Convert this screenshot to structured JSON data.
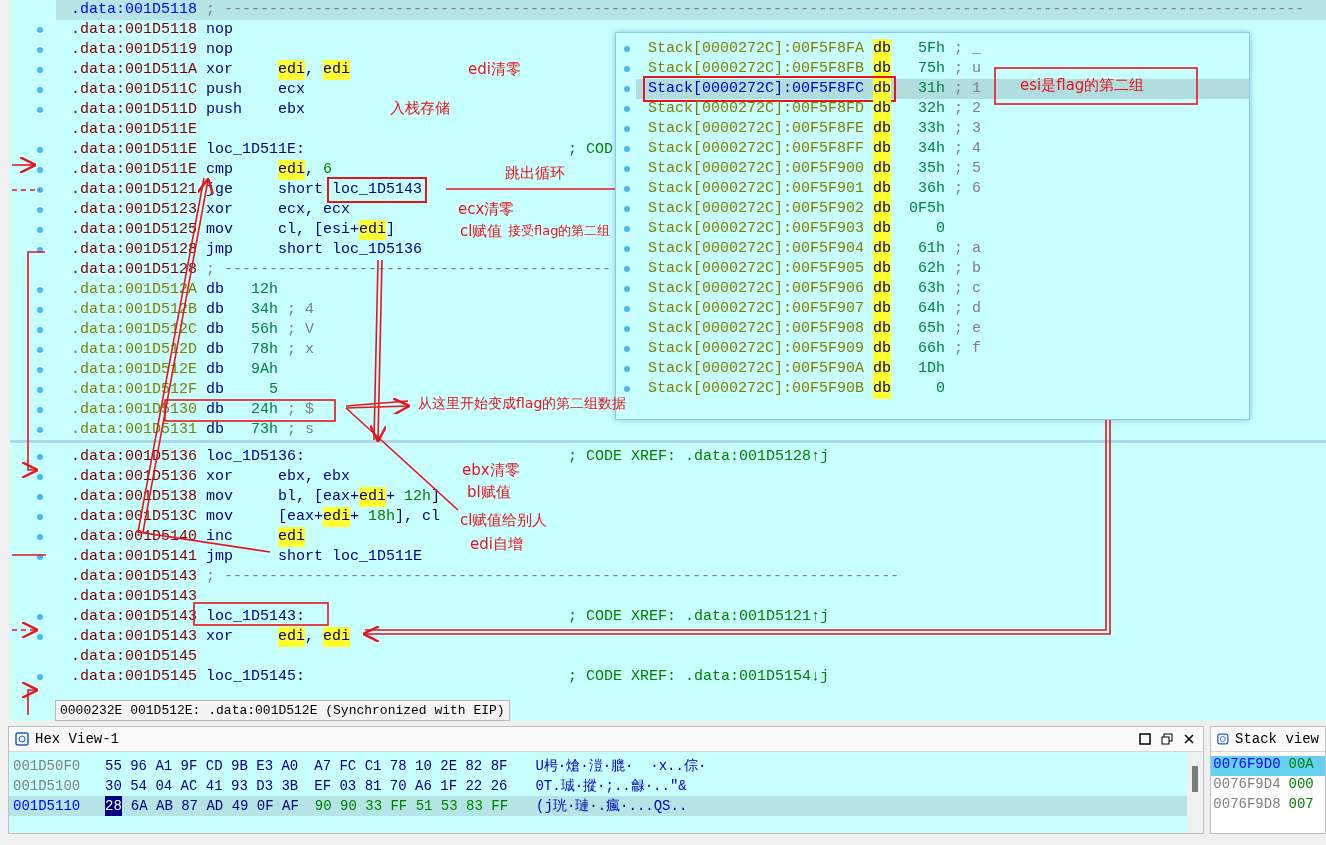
{
  "listing": {
    "lines": [
      {
        "addr": ".data:001D5118",
        "kind": "separator",
        "current": true,
        "text": "; ------------------------------------------------------------------------------------------------------------------------"
      },
      {
        "addr": ".data:001D5118",
        "kind": "insn",
        "current": false,
        "mnem": "nop"
      },
      {
        "addr": ".data:001D5119",
        "kind": "insn",
        "current": false,
        "mnem": "nop"
      },
      {
        "addr": ".data:001D511A",
        "kind": "insn",
        "current": false,
        "mnem": "xor",
        "ops": [
          {
            "text": "edi",
            "kind": "hl"
          },
          {
            "text": ",",
            "kind": "reg"
          },
          {
            "text": "edi",
            "kind": "hl"
          }
        ]
      },
      {
        "addr": ".data:001D511C",
        "kind": "insn",
        "current": false,
        "mnem": "push",
        "ops": [
          {
            "text": "ecx",
            "kind": "reg"
          }
        ]
      },
      {
        "addr": ".data:001D511D",
        "kind": "insn",
        "current": false,
        "mnem": "push",
        "ops": [
          {
            "text": "ebx",
            "kind": "reg"
          }
        ]
      },
      {
        "addr": ".data:001D511E",
        "kind": "blank",
        "current": false
      },
      {
        "addr": ".data:001D511E",
        "kind": "label",
        "current": false,
        "label": "loc_1D511E:",
        "comment": "; COD"
      },
      {
        "addr": ".data:001D511E",
        "kind": "insn",
        "current": false,
        "mnem": "cmp",
        "ops": [
          {
            "text": "edi",
            "kind": "hl"
          },
          {
            "text": ",",
            "kind": "reg"
          },
          {
            "text": "6",
            "kind": "num"
          }
        ]
      },
      {
        "addr": ".data:001D5121",
        "kind": "insn",
        "current": false,
        "mnem": "jge",
        "ops": [
          {
            "text": "short",
            "kind": "reg"
          },
          {
            "text": "loc_1D5143",
            "kind": "reg"
          }
        ]
      },
      {
        "addr": ".data:001D5123",
        "kind": "insn",
        "current": false,
        "mnem": "xor",
        "ops": [
          {
            "text": "ecx, ecx",
            "kind": "reg"
          }
        ]
      },
      {
        "addr": ".data:001D5125",
        "kind": "insn",
        "current": false,
        "mnem": "mov",
        "ops": [
          {
            "text": "cl, [esi+",
            "kind": "reg"
          },
          {
            "text": "edi",
            "kind": "hl"
          },
          {
            "text": "]",
            "kind": "reg"
          }
        ]
      },
      {
        "addr": ".data:001D5128",
        "kind": "insn",
        "current": false,
        "mnem": "jmp",
        "ops": [
          {
            "text": "short loc_1D5136",
            "kind": "reg"
          }
        ]
      },
      {
        "addr": ".data:001D5128",
        "kind": "separator",
        "current": false,
        "text": "; -------------------------------------------"
      },
      {
        "addr": ".data:001D512A",
        "kind": "data",
        "current": false,
        "mnem": "db",
        "value": "12h"
      },
      {
        "addr": ".data:001D512B",
        "kind": "data",
        "current": false,
        "mnem": "db",
        "value": "34h",
        "comment": "; 4"
      },
      {
        "addr": ".data:001D512C",
        "kind": "data",
        "current": false,
        "mnem": "db",
        "value": "56h",
        "comment": "; V"
      },
      {
        "addr": ".data:001D512D",
        "kind": "data",
        "current": false,
        "mnem": "db",
        "value": "78h",
        "comment": "; x"
      },
      {
        "addr": ".data:001D512E",
        "kind": "data",
        "current": false,
        "mnem": "db",
        "value": "9Ah"
      },
      {
        "addr": ".data:001D512F",
        "kind": "data",
        "current": false,
        "mnem": "db",
        "value": "5"
      },
      {
        "addr": ".data:001D5130",
        "kind": "data",
        "current": false,
        "mnem": "db",
        "value": "24h",
        "comment": "; $"
      },
      {
        "addr": ".data:001D5131",
        "kind": "data",
        "current": false,
        "mnem": "db",
        "value": "73h",
        "comment": "; s"
      }
    ]
  },
  "stack_popup": {
    "rows": [
      {
        "addr": "Stack[0000272C]:00F5F8FA",
        "directive": "db",
        "value": "5Fh",
        "comment": "; _",
        "selected": false
      },
      {
        "addr": "Stack[0000272C]:00F5F8FB",
        "directive": "db",
        "value": "75h",
        "comment": "; u",
        "selected": false
      },
      {
        "addr": "Stack[0000272C]:00F5F8FC",
        "directive": "db",
        "value": "31h",
        "comment": "; 1",
        "selected": true
      },
      {
        "addr": "Stack[0000272C]:00F5F8FD",
        "directive": "db",
        "value": "32h",
        "comment": "; 2",
        "selected": false
      },
      {
        "addr": "Stack[0000272C]:00F5F8FE",
        "directive": "db",
        "value": "33h",
        "comment": "; 3",
        "selected": false
      },
      {
        "addr": "Stack[0000272C]:00F5F8FF",
        "directive": "db",
        "value": "34h",
        "comment": "; 4",
        "selected": false
      },
      {
        "addr": "Stack[0000272C]:00F5F900",
        "directive": "db",
        "value": "35h",
        "comment": "; 5",
        "selected": false
      },
      {
        "addr": "Stack[0000272C]:00F5F901",
        "directive": "db",
        "value": "36h",
        "comment": "; 6",
        "selected": false
      },
      {
        "addr": "Stack[0000272C]:00F5F902",
        "directive": "db",
        "value": "0F5h",
        "selected": false
      },
      {
        "addr": "Stack[0000272C]:00F5F903",
        "directive": "db",
        "value": "0",
        "selected": false
      },
      {
        "addr": "Stack[0000272C]:00F5F904",
        "directive": "db",
        "value": "61h",
        "comment": "; a",
        "selected": false
      },
      {
        "addr": "Stack[0000272C]:00F5F905",
        "directive": "db",
        "value": "62h",
        "comment": "; b",
        "selected": false
      },
      {
        "addr": "Stack[0000272C]:00F5F906",
        "directive": "db",
        "value": "63h",
        "comment": "; c",
        "selected": false
      },
      {
        "addr": "Stack[0000272C]:00F5F907",
        "directive": "db",
        "value": "64h",
        "comment": "; d",
        "selected": false
      },
      {
        "addr": "Stack[0000272C]:00F5F908",
        "directive": "db",
        "value": "65h",
        "comment": "; e",
        "selected": false
      },
      {
        "addr": "Stack[0000272C]:00F5F909",
        "directive": "db",
        "value": "66h",
        "comment": "; f",
        "selected": false
      },
      {
        "addr": "Stack[0000272C]:00F5F90A",
        "directive": "db",
        "value": "1Dh",
        "selected": false
      },
      {
        "addr": "Stack[0000272C]:00F5F90B",
        "directive": "db",
        "value": "0",
        "selected": false
      }
    ]
  },
  "lower_listing": {
    "lines": [
      {
        "addr": ".data:001D5136",
        "kind": "label",
        "current": false,
        "label": "loc_1D5136:",
        "comment": "; CODE XREF: .data:001D5128↑j"
      },
      {
        "addr": ".data:001D5136",
        "kind": "insn",
        "current": false,
        "mnem": "xor",
        "ops": [
          {
            "text": "ebx, ebx",
            "kind": "reg"
          }
        ]
      },
      {
        "addr": ".data:001D5138",
        "kind": "insn",
        "current": false,
        "mnem": "mov",
        "ops": [
          {
            "text": "bl, [eax+",
            "kind": "reg"
          },
          {
            "text": "edi",
            "kind": "hl"
          },
          {
            "text": "+",
            "kind": "reg"
          },
          {
            "text": "12h",
            "kind": "num"
          },
          {
            "text": "]",
            "kind": "reg"
          }
        ]
      },
      {
        "addr": ".data:001D513C",
        "kind": "insn",
        "current": false,
        "mnem": "mov",
        "ops": [
          {
            "text": "[eax+",
            "kind": "reg"
          },
          {
            "text": "edi",
            "kind": "hl"
          },
          {
            "text": "+",
            "kind": "reg"
          },
          {
            "text": "18h",
            "kind": "num"
          },
          {
            "text": "], cl",
            "kind": "reg"
          }
        ]
      },
      {
        "addr": ".data:001D5140",
        "kind": "insn",
        "current": false,
        "mnem": "inc",
        "ops": [
          {
            "text": "edi",
            "kind": "hl"
          }
        ]
      },
      {
        "addr": ".data:001D5141",
        "kind": "insn",
        "current": false,
        "mnem": "jmp",
        "ops": [
          {
            "text": "short loc_1D511E",
            "kind": "reg"
          }
        ]
      },
      {
        "addr": ".data:001D5143",
        "kind": "separator",
        "current": false,
        "text": "; ---------------------------------------------------------------------------"
      },
      {
        "addr": ".data:001D5143",
        "kind": "blank",
        "current": false
      },
      {
        "addr": ".data:001D5143",
        "kind": "label",
        "current": false,
        "label": "loc_1D5143:",
        "comment": "; CODE XREF: .data:001D5121↑j"
      },
      {
        "addr": ".data:001D5143",
        "kind": "insn",
        "current": false,
        "mnem": "xor",
        "ops": [
          {
            "text": "edi",
            "kind": "hl"
          },
          {
            "text": ",",
            "kind": "reg"
          },
          {
            "text": "edi",
            "kind": "hl"
          }
        ]
      },
      {
        "addr": ".data:001D5145",
        "kind": "blank",
        "current": false
      },
      {
        "addr": ".data:001D5145",
        "kind": "label",
        "current": false,
        "label": "loc_1D5145:",
        "comment": "; CODE XREF: .data:001D5154↓j"
      }
    ],
    "status": "0000232E 001D512E: .data:001D512E (Synchronized with EIP)"
  },
  "notes": [
    {
      "text": "edi清零"
    },
    {
      "text": "入栈存储"
    },
    {
      "text": "跳出循环"
    },
    {
      "text": "ecx清零"
    },
    {
      "text": "cl赋值"
    },
    {
      "text": "接受flag的第二组"
    },
    {
      "text": "从这里开始变成flag的第二组数据"
    },
    {
      "text": "esi是flag的第二组"
    },
    {
      "text": "ebx清零"
    },
    {
      "text": "bl赋值"
    },
    {
      "text": "cl赋值给别人"
    },
    {
      "text": "edi自增"
    }
  ],
  "hex_view": {
    "title": "Hex View-1",
    "rows": [
      {
        "addr": "001D50F0",
        "selected": false,
        "groups": [
          {
            "bytes": "55 96 A1 9F CD 9B E3 A0",
            "cursor": false,
            "code": false
          },
          {
            "bytes": "A7 FC C1 78 10 2E 82 8F",
            "cursor": false,
            "code": false
          }
        ],
        "ascii": "U枵·熗·溰·膍·  ·x..倧·"
      },
      {
        "addr": "001D5100",
        "selected": false,
        "groups": [
          {
            "bytes": "30 54 04 AC 41 93 D3 3B",
            "cursor": false,
            "code": false
          },
          {
            "bytes": "EF 03 81 70 A6 1F 22 26",
            "cursor": false,
            "code": false
          }
        ],
        "ascii": "0T.珹·摐·;..龣·..\"&"
      },
      {
        "addr": "001D5110",
        "selected": true,
        "groups": [
          {
            "bytes": "28",
            "cursor": true,
            "code": false
          },
          {
            "bytes": "6A AB 87 AD 49 0F AF",
            "cursor": false,
            "code": false
          },
          {
            "bytes": "90 90 33 FF 51 53 83 FF",
            "cursor": false,
            "code": true
          }
        ],
        "ascii": "(j珖·璉·.瘋·...QS.."
      }
    ]
  },
  "stack_view": {
    "title": "Stack view",
    "rows": [
      {
        "addr": "0076F9D0",
        "value": "00A",
        "selected": true
      },
      {
        "addr": "0076F9D4",
        "value": "000",
        "selected": false
      },
      {
        "addr": "0076F9D8",
        "value": "007",
        "selected": false
      }
    ]
  }
}
